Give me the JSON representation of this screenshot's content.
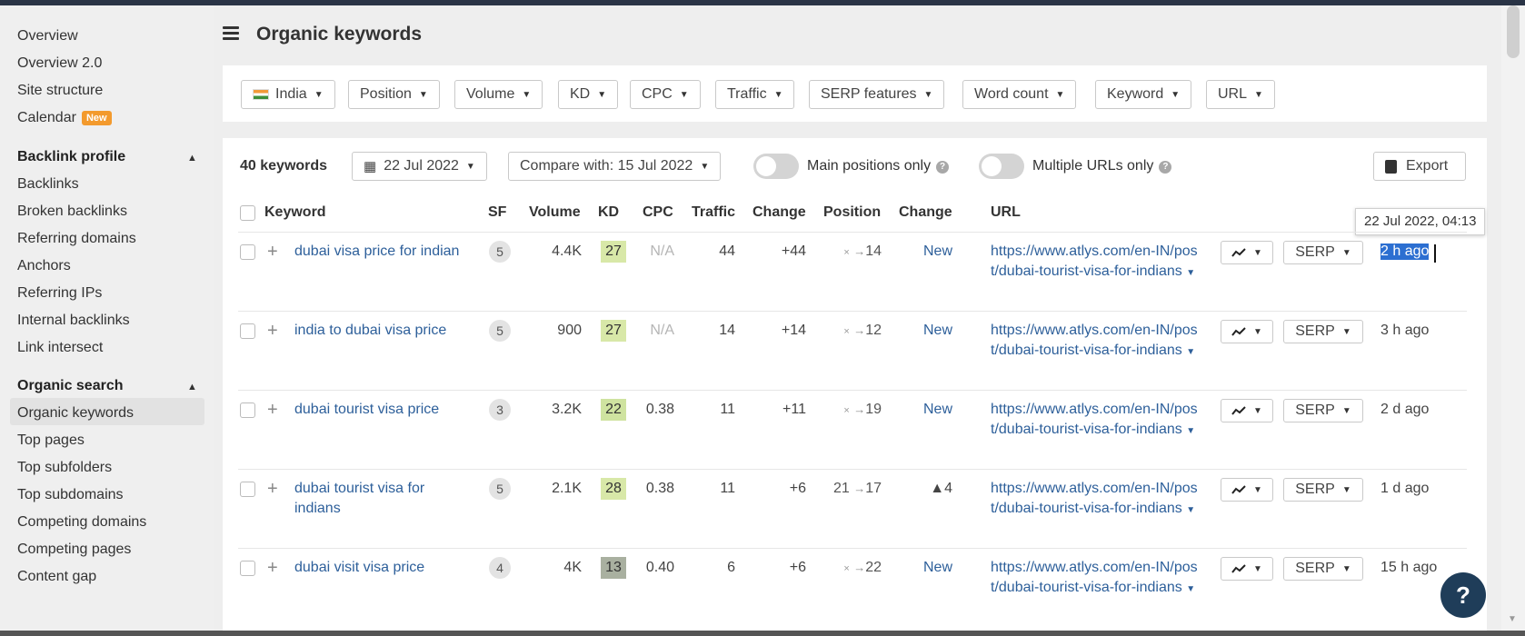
{
  "page_title": "Organic keywords",
  "sidebar": {
    "top_items": [
      "Overview",
      "Overview 2.0",
      "Site structure",
      "Calendar"
    ],
    "calendar_badge": "New",
    "backlink_header": "Backlink profile",
    "backlink_items": [
      "Backlinks",
      "Broken backlinks",
      "Referring domains",
      "Anchors",
      "Referring IPs",
      "Internal backlinks",
      "Link intersect"
    ],
    "organic_header": "Organic search",
    "organic_items": [
      "Organic keywords",
      "Top pages",
      "Top subfolders",
      "Top subdomains",
      "Competing domains",
      "Competing pages",
      "Content gap"
    ],
    "active_item": "Organic keywords"
  },
  "filters": [
    "India",
    "Position",
    "Volume",
    "KD",
    "CPC",
    "Traffic",
    "SERP features",
    "Word count",
    "Keyword",
    "URL"
  ],
  "toolbar": {
    "count": "40 keywords",
    "date": "22 Jul 2022",
    "compare": "Compare with: 15 Jul 2022",
    "main_positions": "Main positions only",
    "multiple_urls": "Multiple URLs only",
    "export": "Export"
  },
  "columns": [
    "Keyword",
    "SF",
    "Volume",
    "KD",
    "CPC",
    "Traffic",
    "Change",
    "Position",
    "Change",
    "URL"
  ],
  "tooltip": "22 Jul 2022, 04:13",
  "rows": [
    {
      "keyword": "dubai visa price for indian",
      "sf": "5",
      "volume": "4.4K",
      "kd": "27",
      "cpc": "N/A",
      "traffic": "44",
      "change": "+44",
      "pos_from": "×",
      "pos_to": "14",
      "pos_change": "New",
      "url": "https://www.atlys.com/en-IN/post/dubai-tourist-visa-for-indians",
      "serp": "SERP",
      "updated": "2 h ago"
    },
    {
      "keyword": "india to dubai visa price",
      "sf": "5",
      "volume": "900",
      "kd": "27",
      "cpc": "N/A",
      "traffic": "14",
      "change": "+14",
      "pos_from": "×",
      "pos_to": "12",
      "pos_change": "New",
      "url": "https://www.atlys.com/en-IN/post/dubai-tourist-visa-for-indians",
      "serp": "SERP",
      "updated": "3 h ago"
    },
    {
      "keyword": "dubai tourist visa price",
      "sf": "3",
      "volume": "3.2K",
      "kd": "22",
      "cpc": "0.38",
      "traffic": "11",
      "change": "+11",
      "pos_from": "×",
      "pos_to": "19",
      "pos_change": "New",
      "url": "https://www.atlys.com/en-IN/post/dubai-tourist-visa-for-indians",
      "serp": "SERP",
      "updated": "2 d ago"
    },
    {
      "keyword": "dubai tourist visa for indians",
      "sf": "5",
      "volume": "2.1K",
      "kd": "28",
      "cpc": "0.38",
      "traffic": "11",
      "change": "+6",
      "pos_from": "21",
      "pos_to": "17",
      "pos_change": "▲4",
      "url": "https://www.atlys.com/en-IN/post/dubai-tourist-visa-for-indians",
      "serp": "SERP",
      "updated": "1 d ago"
    },
    {
      "keyword": "dubai visit visa price",
      "sf": "4",
      "volume": "4K",
      "kd": "13",
      "cpc": "0.40",
      "traffic": "6",
      "change": "+6",
      "pos_from": "×",
      "pos_to": "22",
      "pos_change": "New",
      "url": "https://www.atlys.com/en-IN/post/dubai-tourist-visa-for-indians",
      "serp": "SERP",
      "updated": "15 h ago"
    }
  ],
  "kd_colors": {
    "27": "#d8e8a8",
    "22": "#cfe3a0",
    "28": "#d8e8a8",
    "13": "#a9b0a0"
  },
  "help_fab": "?"
}
